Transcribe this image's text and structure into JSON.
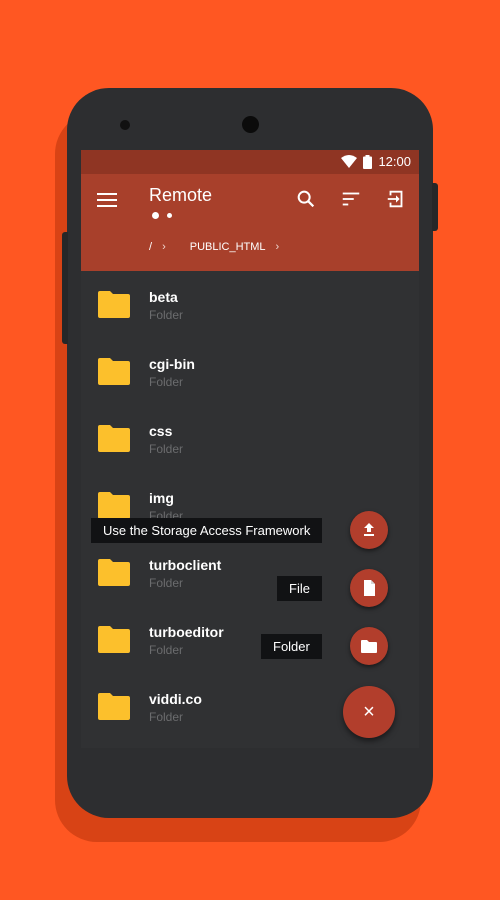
{
  "colors": {
    "background": "#ff5722",
    "toolbar": "#a8402b",
    "statusbar": "#8f3523",
    "list_bg": "#303133",
    "folder": "#fcc02c",
    "fab": "#b23e2c"
  },
  "statusbar": {
    "time": "12:00",
    "icons": [
      "wifi-icon",
      "battery-icon"
    ]
  },
  "toolbar": {
    "title": "Remote",
    "page_indicator": {
      "pages": 2,
      "active": 1
    },
    "icons": [
      "menu-icon",
      "search-icon",
      "sort-icon",
      "logout-icon"
    ]
  },
  "breadcrumb": {
    "items": [
      "/",
      "PUBLIC_HTML"
    ],
    "separator": "›"
  },
  "files": [
    {
      "name": "beta",
      "type": "Folder"
    },
    {
      "name": "cgi-bin",
      "type": "Folder"
    },
    {
      "name": "css",
      "type": "Folder"
    },
    {
      "name": "img",
      "type": "Folder"
    },
    {
      "name": "turboclient",
      "type": "Folder"
    },
    {
      "name": "turboeditor",
      "type": "Folder"
    },
    {
      "name": "viddi.co",
      "type": "Folder"
    }
  ],
  "fab_menu": {
    "upload_label": "Use the Storage Access Framework",
    "file_label": "File",
    "folder_label": "Folder",
    "close_symbol": "×"
  }
}
